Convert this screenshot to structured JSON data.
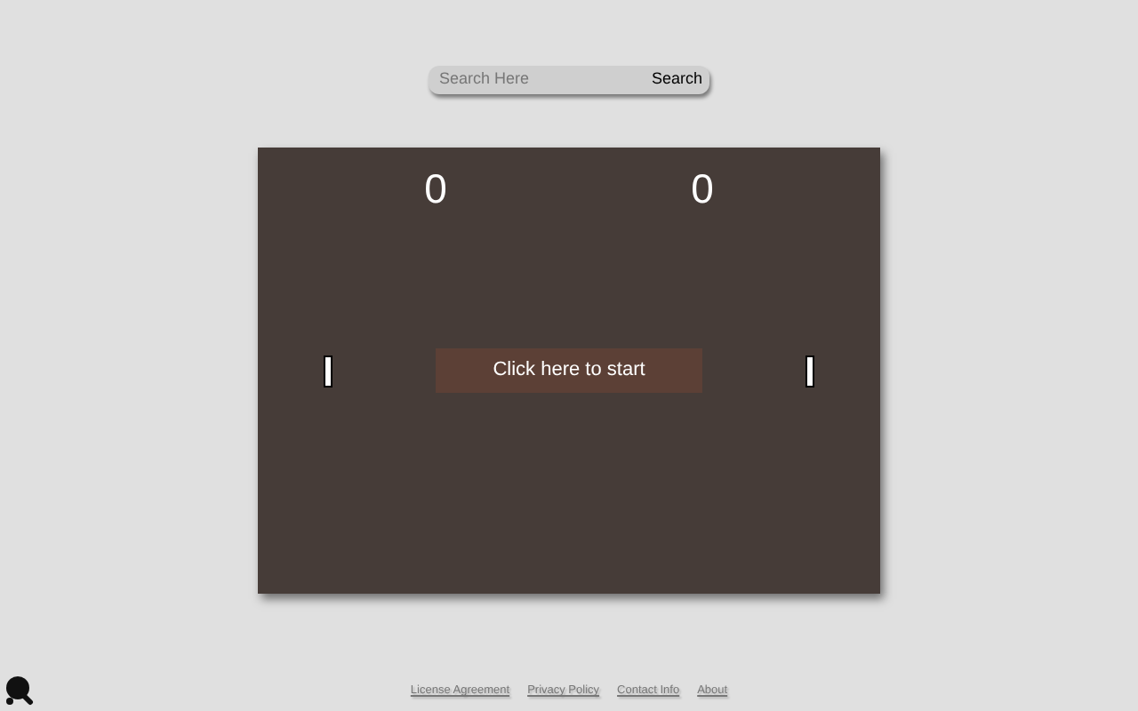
{
  "search": {
    "placeholder": "Search Here",
    "button": "Search"
  },
  "game": {
    "scores": [
      "0",
      "0"
    ],
    "start_button": "Click here to start"
  },
  "footer": {
    "links": [
      "License Agreement",
      "Privacy Policy",
      "Contact Info",
      "About"
    ]
  }
}
